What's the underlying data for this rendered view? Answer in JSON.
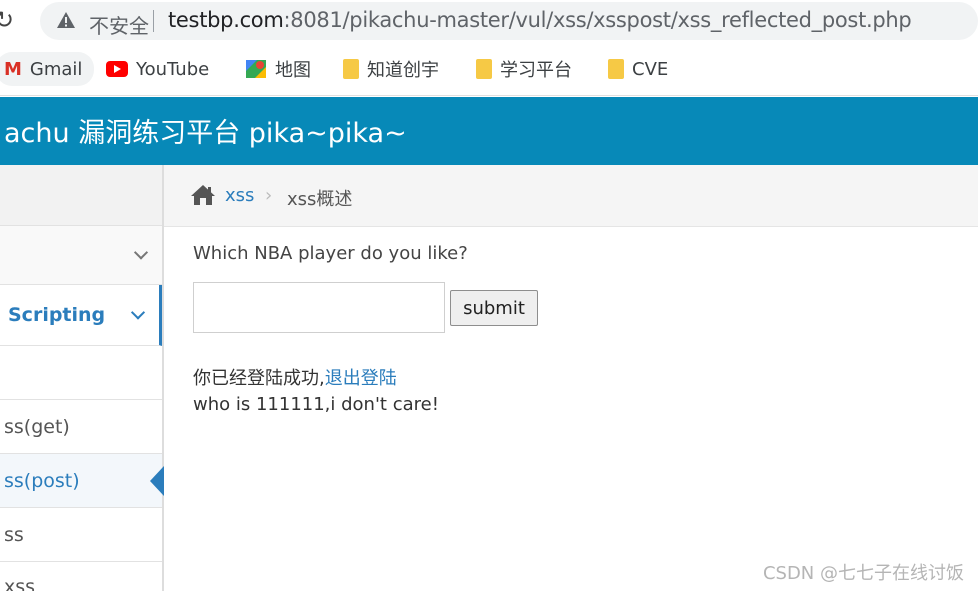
{
  "browser": {
    "security_label": "不安全",
    "url_host": "testbp.com",
    "url_rest": ":8081/pikachu-master/vul/xss/xsspost/xss_reflected_post.php",
    "icons": {
      "reload": "reload-icon",
      "warning": "warning-triangle-icon"
    }
  },
  "bookmarks": [
    {
      "label": "Gmail",
      "icon": "gmail-icon"
    },
    {
      "label": "YouTube",
      "icon": "youtube-icon"
    },
    {
      "label": "地图",
      "icon": "maps-icon"
    },
    {
      "label": "知道创宇",
      "icon": "folder-icon"
    },
    {
      "label": "学习平台",
      "icon": "folder-icon"
    },
    {
      "label": "CVE",
      "icon": "folder-icon"
    }
  ],
  "header": {
    "title": "achu 漏洞练习平台 pika~pika~"
  },
  "sidebar": {
    "items": [
      {
        "label": ""
      },
      {
        "label": "Scripting"
      },
      {
        "label": ""
      },
      {
        "label": "ss(get)"
      },
      {
        "label": "ss(post)"
      },
      {
        "label": "ss"
      },
      {
        "label": "xss"
      }
    ]
  },
  "breadcrumb": {
    "link": "xss",
    "separator": "›",
    "current": "xss概述"
  },
  "main": {
    "question": "Which NBA player do you like?",
    "input_value": "",
    "submit_label": "submit",
    "login_text": "你已经登陆成功,",
    "logout_link": "退出登陆",
    "result_text": "who is 111111,i don't care!"
  },
  "watermark": "CSDN @七七子在线讨饭",
  "colors": {
    "header_bg": "#0789b8",
    "link": "#2b7dbc",
    "omnibox_bg": "#f1f3f4"
  }
}
